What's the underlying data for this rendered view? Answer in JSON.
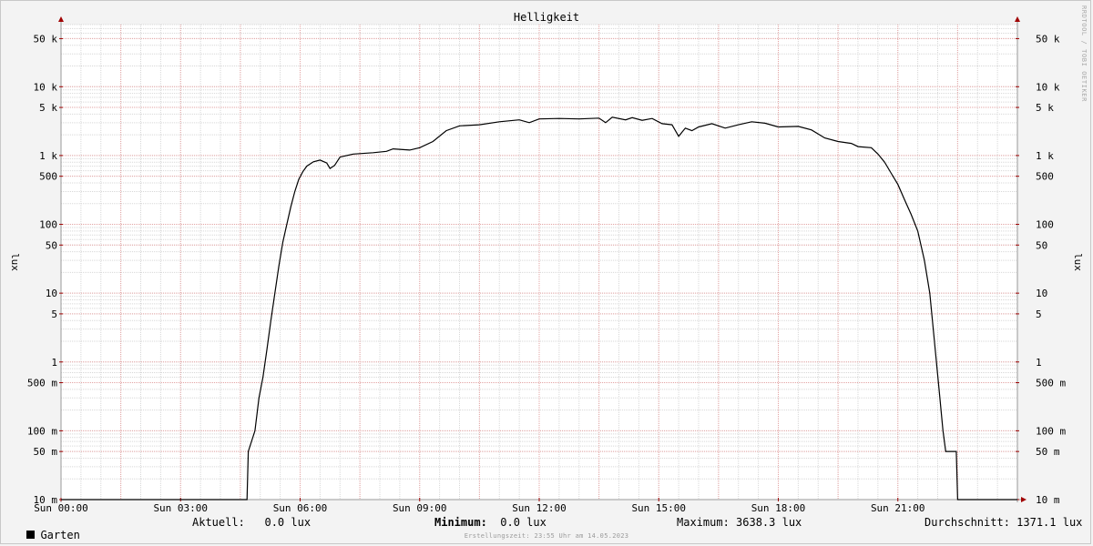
{
  "chart_data": {
    "type": "line",
    "title": "Helligkeit",
    "ylabel": "lux",
    "y_scale": "log",
    "ylim": [
      0.01,
      80000
    ],
    "y_ticks": [
      {
        "value": 50000,
        "label": "50 k"
      },
      {
        "value": 10000,
        "label": "10 k"
      },
      {
        "value": 5000,
        "label": "5 k"
      },
      {
        "value": 1000,
        "label": "1 k"
      },
      {
        "value": 500,
        "label": "500"
      },
      {
        "value": 100,
        "label": "100"
      },
      {
        "value": 50,
        "label": "50"
      },
      {
        "value": 10,
        "label": "10"
      },
      {
        "value": 5,
        "label": "5"
      },
      {
        "value": 1,
        "label": "1"
      },
      {
        "value": 0.5,
        "label": "500 m"
      },
      {
        "value": 0.1,
        "label": "100 m"
      },
      {
        "value": 0.05,
        "label": "50 m"
      },
      {
        "value": 0.01,
        "label": "10 m"
      }
    ],
    "xlim": [
      "00:00",
      "24:00"
    ],
    "x_ticks": [
      {
        "value": "00:00",
        "label": "Sun 00:00"
      },
      {
        "value": "03:00",
        "label": "Sun 03:00"
      },
      {
        "value": "06:00",
        "label": "Sun 06:00"
      },
      {
        "value": "09:00",
        "label": "Sun 09:00"
      },
      {
        "value": "12:00",
        "label": "Sun 12:00"
      },
      {
        "value": "15:00",
        "label": "Sun 15:00"
      },
      {
        "value": "18:00",
        "label": "Sun 18:00"
      },
      {
        "value": "21:00",
        "label": "Sun 21:00"
      }
    ],
    "grid": true,
    "series": [
      {
        "name": "Garten",
        "color": "#000000",
        "points": [
          [
            "00:00",
            0.01
          ],
          [
            "04:40",
            0.01
          ],
          [
            "04:42",
            0.05
          ],
          [
            "04:52",
            0.1
          ],
          [
            "04:58",
            0.3
          ],
          [
            "05:04",
            0.6
          ],
          [
            "05:10",
            1.5
          ],
          [
            "05:16",
            4
          ],
          [
            "05:22",
            10
          ],
          [
            "05:28",
            25
          ],
          [
            "05:34",
            55
          ],
          [
            "05:40",
            100
          ],
          [
            "05:46",
            180
          ],
          [
            "05:52",
            300
          ],
          [
            "05:58",
            450
          ],
          [
            "06:04",
            580
          ],
          [
            "06:10",
            700
          ],
          [
            "06:20",
            810
          ],
          [
            "06:30",
            860
          ],
          [
            "06:40",
            780
          ],
          [
            "06:45",
            650
          ],
          [
            "06:52",
            720
          ],
          [
            "07:00",
            950
          ],
          [
            "07:20",
            1050
          ],
          [
            "07:50",
            1100
          ],
          [
            "08:10",
            1150
          ],
          [
            "08:20",
            1250
          ],
          [
            "08:45",
            1200
          ],
          [
            "09:00",
            1300
          ],
          [
            "09:20",
            1600
          ],
          [
            "09:40",
            2300
          ],
          [
            "10:00",
            2700
          ],
          [
            "10:30",
            2800
          ],
          [
            "11:00",
            3100
          ],
          [
            "11:30",
            3300
          ],
          [
            "11:45",
            3000
          ],
          [
            "12:00",
            3400
          ],
          [
            "12:30",
            3450
          ],
          [
            "13:00",
            3400
          ],
          [
            "13:30",
            3500
          ],
          [
            "13:40",
            3000
          ],
          [
            "13:50",
            3600
          ],
          [
            "14:10",
            3300
          ],
          [
            "14:20",
            3550
          ],
          [
            "14:35",
            3250
          ],
          [
            "14:50",
            3450
          ],
          [
            "15:05",
            2900
          ],
          [
            "15:20",
            2800
          ],
          [
            "15:30",
            1900
          ],
          [
            "15:40",
            2500
          ],
          [
            "15:50",
            2300
          ],
          [
            "16:00",
            2600
          ],
          [
            "16:20",
            2900
          ],
          [
            "16:40",
            2500
          ],
          [
            "17:00",
            2800
          ],
          [
            "17:20",
            3100
          ],
          [
            "17:40",
            2950
          ],
          [
            "18:00",
            2600
          ],
          [
            "18:30",
            2650
          ],
          [
            "18:50",
            2350
          ],
          [
            "19:10",
            1800
          ],
          [
            "19:30",
            1600
          ],
          [
            "19:50",
            1500
          ],
          [
            "20:00",
            1350
          ],
          [
            "20:20",
            1300
          ],
          [
            "20:30",
            1050
          ],
          [
            "20:40",
            800
          ],
          [
            "20:50",
            550
          ],
          [
            "21:00",
            380
          ],
          [
            "21:10",
            230
          ],
          [
            "21:20",
            140
          ],
          [
            "21:30",
            80
          ],
          [
            "21:40",
            30
          ],
          [
            "21:48",
            10
          ],
          [
            "21:55",
            2
          ],
          [
            "22:02",
            0.4
          ],
          [
            "22:08",
            0.1
          ],
          [
            "22:12",
            0.05
          ],
          [
            "22:28",
            0.05
          ],
          [
            "22:30",
            0.01
          ],
          [
            "24:00",
            0.01
          ]
        ]
      }
    ],
    "legend": {
      "label": "Garten",
      "aktuell": "Aktuell:   0.0 lux",
      "minimum_label": "Minimum:",
      "minimum_value": "  0.0 lux",
      "maximum": "Maximum: 3638.3 lux",
      "durchschnitt": "Durchschnitt: 1371.1 lux"
    },
    "footer": "Erstellungszeit: 23:55 Uhr am 14.05.2023",
    "watermark": "RRDTOOL / TOBI OETIKER"
  }
}
